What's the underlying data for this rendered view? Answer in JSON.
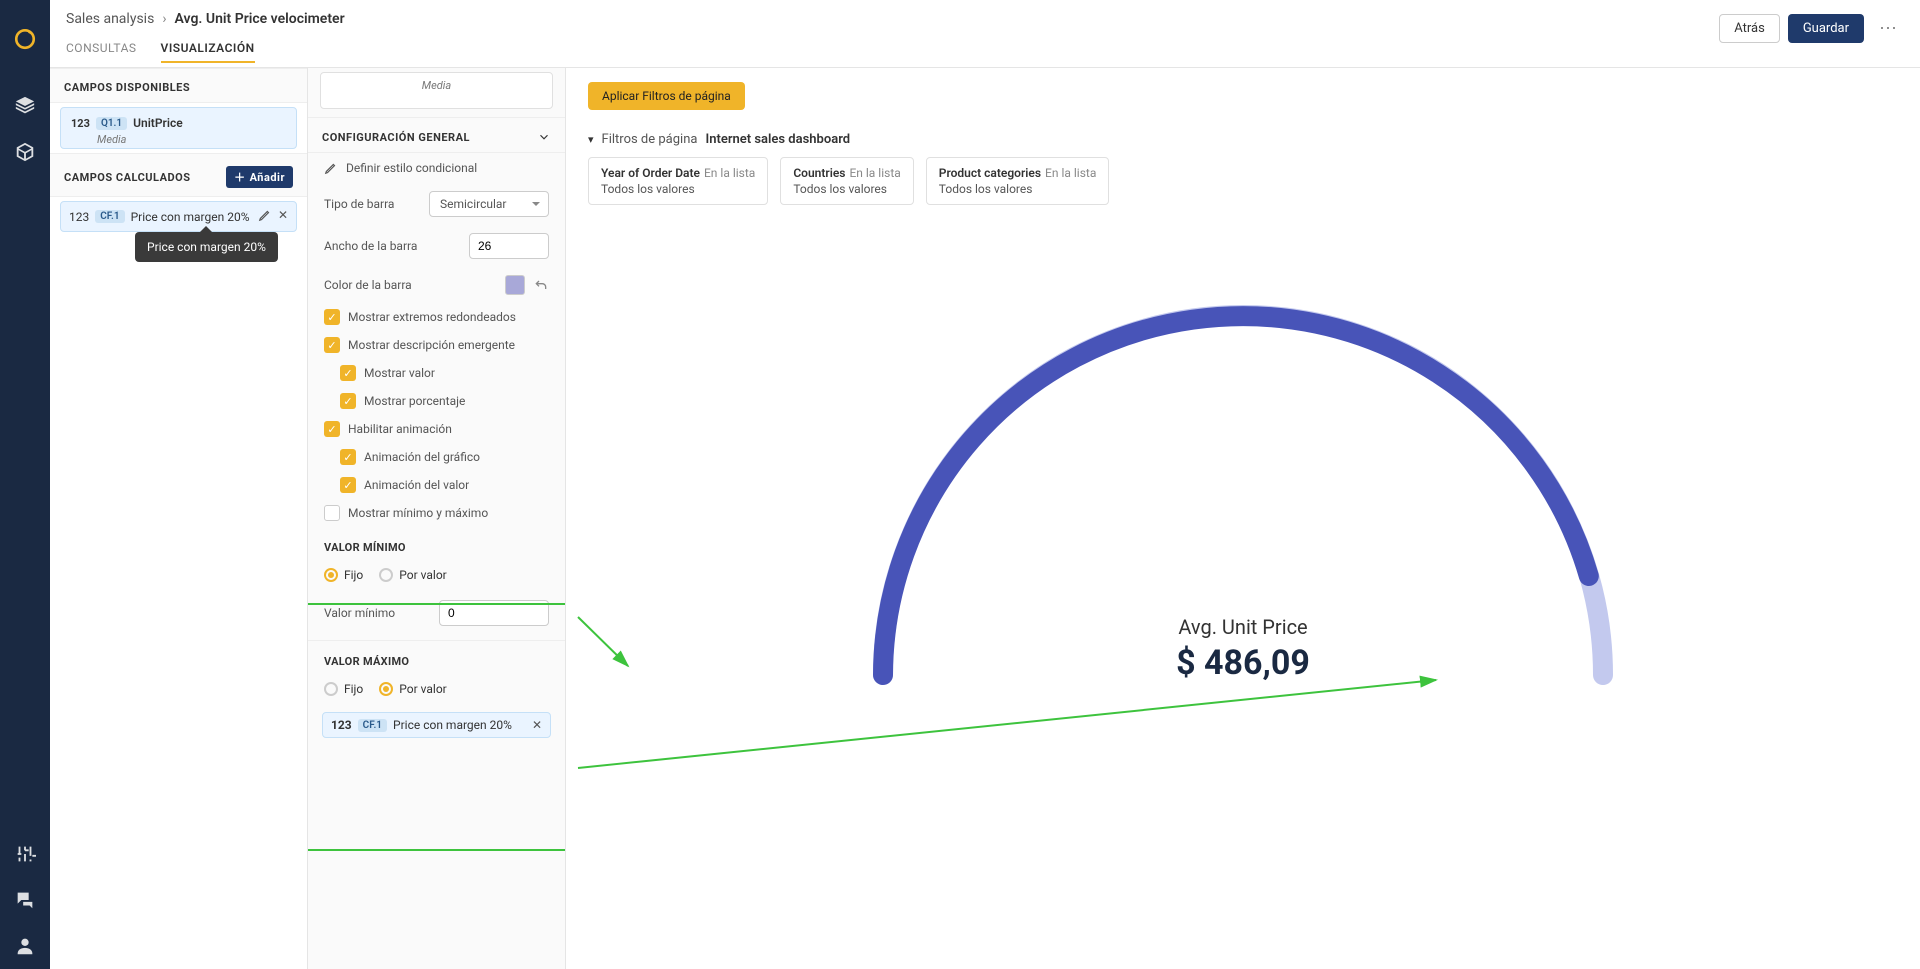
{
  "breadcrumb": {
    "parent": "Sales analysis",
    "current": "Avg. Unit Price velocimeter"
  },
  "topbar": {
    "back": "Atrás",
    "save": "Guardar"
  },
  "tabs": {
    "consultas": "CONSULTAS",
    "visualizacion": "VISUALIZACIÓN"
  },
  "left": {
    "available_h": "CAMPOS DISPONIBLES",
    "calc_h": "CAMPOS CALCULADOS",
    "add": "Añadir",
    "field": {
      "type": "123",
      "badge": "Q1.1",
      "name": "UnitPrice",
      "sub": "Media"
    },
    "calc": {
      "type": "123",
      "badge": "CF.1",
      "name": "Price con margen 20%"
    },
    "tooltip": "Price con margen 20%"
  },
  "mid": {
    "media_chip": "Media",
    "cfg_general": "CONFIGURACIÓN GENERAL",
    "cond_style": "Definir estilo condicional",
    "tipo_barra_lbl": "Tipo de barra",
    "tipo_barra_val": "Semicircular",
    "ancho_lbl": "Ancho de la barra",
    "ancho_val": "26",
    "color_lbl": "Color de la barra",
    "chk1": "Mostrar extremos redondeados",
    "chk2": "Mostrar descripción emergente",
    "chk3": "Mostrar valor",
    "chk4": "Mostrar porcentaje",
    "chk5": "Habilitar animación",
    "chk6": "Animación del gráfico",
    "chk7": "Animación del valor",
    "chk8": "Mostrar mínimo y máximo",
    "min_h": "VALOR MÍNIMO",
    "max_h": "VALOR MÁXIMO",
    "fijo": "Fijo",
    "por_valor": "Por valor",
    "min_lbl": "Valor mínimo",
    "min_val": "0",
    "max_chip": {
      "type": "123",
      "badge": "CF.1",
      "name": "Price con margen 20%"
    }
  },
  "right": {
    "apply_filters": "Aplicar Filtros de página",
    "filt_lbl": "Filtros de página",
    "filt_name": "Internet sales dashboard",
    "f1": {
      "t": "Year of Order Date",
      "s": "En la lista",
      "v": "Todos los valores"
    },
    "f2": {
      "t": "Countries",
      "s": "En la lista",
      "v": "Todos los valores"
    },
    "f3": {
      "t": "Product categories",
      "s": "En la lista",
      "v": "Todos los valores"
    },
    "gauge": {
      "lbl": "Avg. Unit Price",
      "val": "$ 486,09"
    }
  },
  "colors": {
    "gauge_fill": "#4854b8",
    "gauge_bg": "#c3c9ee",
    "highlight": "#3dc33d"
  },
  "chart_data": {
    "type": "gauge",
    "title": "Avg. Unit Price",
    "value_display": "$ 486,09",
    "value": 486.09,
    "min": 0,
    "max": 583.3,
    "fill_fraction": 0.833
  }
}
